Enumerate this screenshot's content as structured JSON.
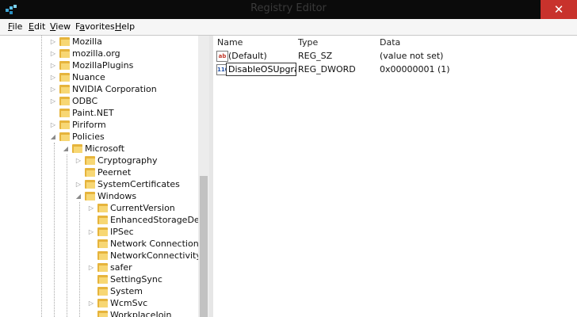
{
  "window": {
    "title": "Registry Editor",
    "close_glyph": "✕"
  },
  "menu": [
    {
      "key": "F",
      "rest": "ile"
    },
    {
      "key": "E",
      "rest": "dit"
    },
    {
      "key": "V",
      "rest": "iew"
    },
    {
      "key": "F",
      "rest": "avorites",
      "prefix": "Fa",
      "tail": "vorites"
    },
    {
      "key": "H",
      "rest": "elp"
    }
  ],
  "tree": {
    "items": [
      {
        "label": "Mozilla",
        "expander": "collapsed"
      },
      {
        "label": "mozilla.org",
        "expander": "collapsed"
      },
      {
        "label": "MozillaPlugins",
        "expander": "collapsed"
      },
      {
        "label": "Nuance",
        "expander": "collapsed"
      },
      {
        "label": "NVIDIA Corporation",
        "expander": "collapsed"
      },
      {
        "label": "ODBC",
        "expander": "collapsed"
      },
      {
        "label": "Paint.NET",
        "expander": "none"
      },
      {
        "label": "Piriform",
        "expander": "collapsed"
      },
      {
        "label": "Policies",
        "expander": "expanded"
      },
      {
        "label": "Microsoft",
        "expander": "expanded"
      },
      {
        "label": "Cryptography",
        "expander": "collapsed"
      },
      {
        "label": "Peernet",
        "expander": "none"
      },
      {
        "label": "SystemCertificates",
        "expander": "collapsed"
      },
      {
        "label": "Windows",
        "expander": "expanded"
      },
      {
        "label": "CurrentVersion",
        "expander": "collapsed"
      },
      {
        "label": "EnhancedStorageDevices",
        "expander": "none"
      },
      {
        "label": "IPSec",
        "expander": "collapsed"
      },
      {
        "label": "Network Connections",
        "expander": "none"
      },
      {
        "label": "NetworkConnectivityStatusIndicator",
        "expander": "none"
      },
      {
        "label": "safer",
        "expander": "collapsed"
      },
      {
        "label": "SettingSync",
        "expander": "none"
      },
      {
        "label": "System",
        "expander": "none"
      },
      {
        "label": "WcmSvc",
        "expander": "collapsed"
      },
      {
        "label": "WorkplaceJoin",
        "expander": "none"
      }
    ]
  },
  "list": {
    "headers": {
      "name": "Name",
      "type": "Type",
      "data": "Data"
    },
    "rows": [
      {
        "icon": "ab",
        "name": "(Default)",
        "type": "REG_SZ",
        "data": "(value not set)"
      },
      {
        "icon": "110",
        "name": "DisableOSUpgrade",
        "type": "REG_DWORD",
        "data": "0x00000001 (1)"
      }
    ]
  }
}
